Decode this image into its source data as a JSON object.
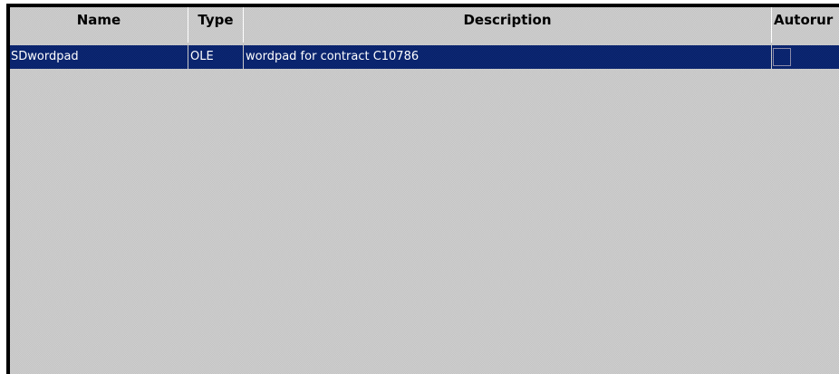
{
  "table": {
    "columns": {
      "name": "Name",
      "type": "Type",
      "description": "Description",
      "autorun": "Autorur"
    },
    "rows": [
      {
        "name": "SDwordpad",
        "type": "OLE",
        "description": "wordpad for contract C10786",
        "autorun": false,
        "selected": true
      }
    ]
  },
  "colors": {
    "selection": "#0b2a7a",
    "background": "#c3c3c3",
    "frame": "#000000"
  }
}
